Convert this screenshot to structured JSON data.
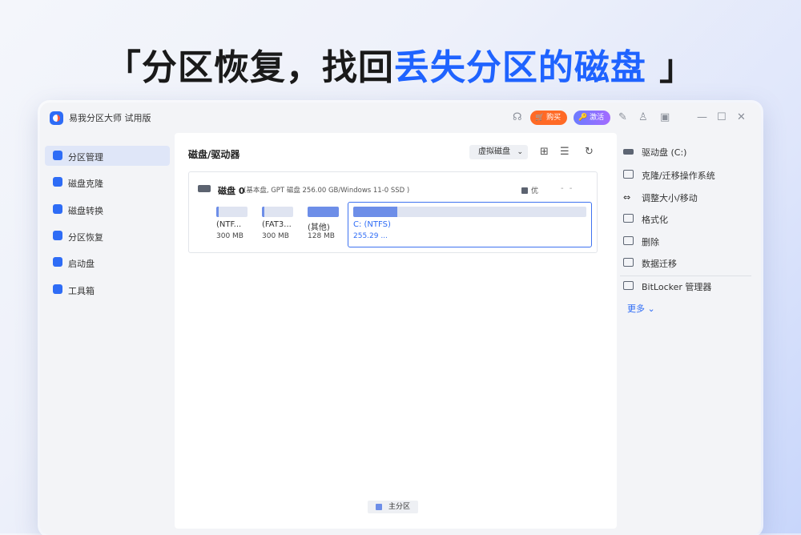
{
  "headline": {
    "prefix": "「分区恢复，找回",
    "highlight": "丢失分区的磁盘",
    "suffix": " 」"
  },
  "app": {
    "title": "易我分区大师 试用版",
    "buy_label": "购买",
    "activate_label": "激活"
  },
  "colors": {
    "accent": "#2e6cf6",
    "highlight": "#1f63ff",
    "buy": "#ff6a26",
    "partition_fill": "#6d8ee8"
  },
  "sidebar": {
    "items": [
      {
        "label": "分区管理",
        "icon": "pie-chart-icon"
      },
      {
        "label": "磁盘克隆",
        "icon": "clone-icon"
      },
      {
        "label": "磁盘转换",
        "icon": "convert-icon"
      },
      {
        "label": "分区恢复",
        "icon": "recover-icon"
      },
      {
        "label": "启动盘",
        "icon": "usb-icon"
      },
      {
        "label": "工具箱",
        "icon": "toolbox-icon"
      }
    ]
  },
  "main": {
    "title": "磁盘/驱动器",
    "view_select": "虚拟磁盘",
    "disk": {
      "name": "磁盘 0",
      "info": "(基本盘, GPT 磁盘 256.00 GB/Windows 11-0 SSD )",
      "badge": "优",
      "dash": "- -",
      "partitions": [
        {
          "name": "(NTF...",
          "size": "300 MB",
          "used_fraction": 0.08
        },
        {
          "name": "(FAT3...",
          "size": "300 MB",
          "used_fraction": 0.08
        },
        {
          "name": "(其他)",
          "size": "128 MB",
          "used_fraction": 1.0
        },
        {
          "name": "C: (NTFS)",
          "size": "255.29 ...",
          "used_fraction": 0.19
        }
      ]
    },
    "legend": "主分区"
  },
  "right_panel": {
    "drive": "驱动盘 (C:)",
    "actions": [
      "克隆/迁移操作系统",
      "调整大小/移动",
      "格式化",
      "删除",
      "数据迁移"
    ],
    "bitlocker": "BitLocker 管理器",
    "more": "更多"
  }
}
